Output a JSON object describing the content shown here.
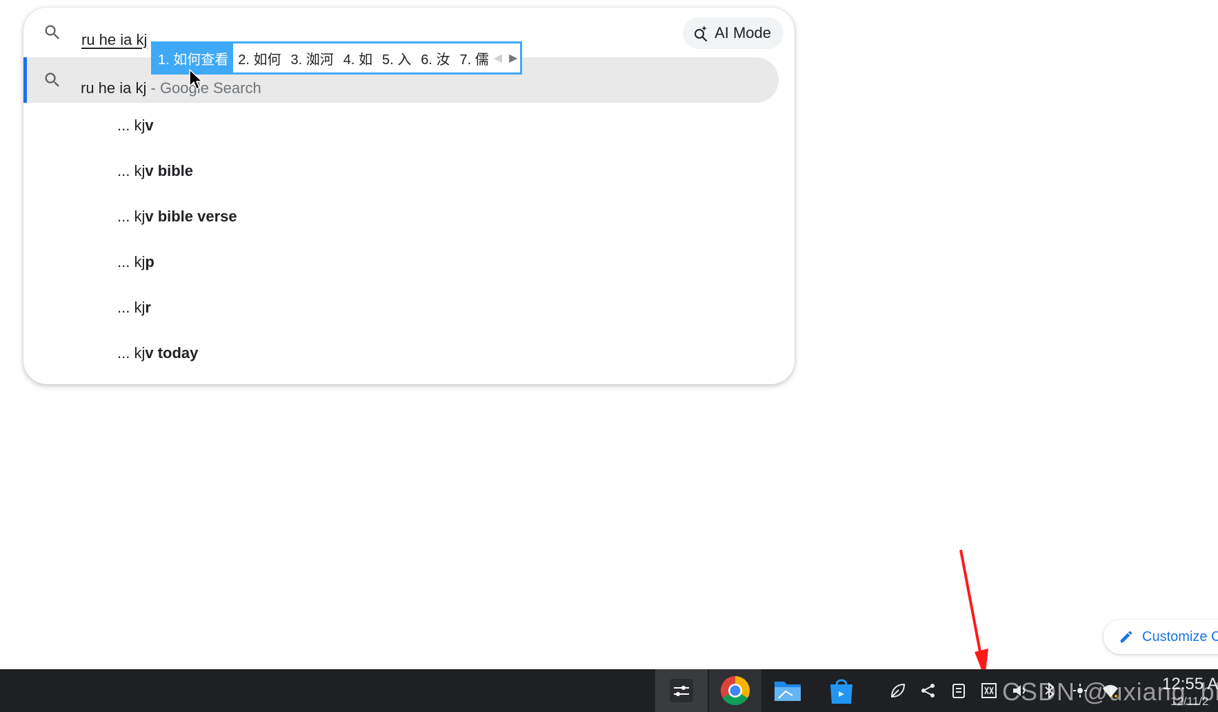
{
  "search": {
    "query": "ru he ia kj",
    "ai_mode_label": "AI Mode"
  },
  "ime": {
    "candidates": [
      "1. 如何查看",
      "2. 如何",
      "3. 洳河",
      "4. 如",
      "5. 入",
      "6. 汝",
      "7. 儒"
    ],
    "selected_index": 0,
    "prev_page": "◀",
    "next_page": "▶"
  },
  "suggestions": {
    "first": {
      "text": "ru he ia kj",
      "suffix": " - Google Search"
    },
    "items": [
      {
        "prefix": "... kj",
        "bold": "v"
      },
      {
        "prefix": "... kj",
        "bold": "v bible"
      },
      {
        "prefix": "... kj",
        "bold": "v bible verse"
      },
      {
        "prefix": "... kj",
        "bold": "p"
      },
      {
        "prefix": "... kj",
        "bold": "r"
      },
      {
        "prefix": "... kj",
        "bold": "v today"
      }
    ]
  },
  "customize": {
    "label": "Customize C"
  },
  "taskbar": {
    "apps": [
      "settings-app",
      "chrome-app",
      "files-app",
      "store-app"
    ],
    "tray_icons": [
      "leaf-icon",
      "share-network-icon",
      "clipboard-icon",
      "input-method-icon",
      "volume-icon",
      "bluetooth-icon",
      "network-icon",
      "wifi-icon"
    ],
    "clock_time": "12:55 A",
    "clock_date": "12/11/2"
  },
  "watermark": "CSDN @uxiang_blog",
  "colors": {
    "accent_blue": "#1a73e8",
    "ime_blue": "#3fa9f5",
    "taskbar_bg": "#1f2023",
    "arrow_red": "#ff1a1a"
  }
}
